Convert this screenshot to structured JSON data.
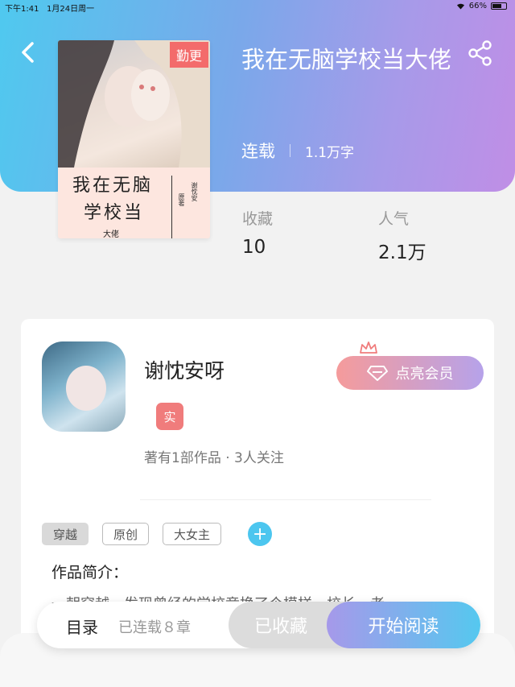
{
  "status_bar": {
    "time": "下午1:41",
    "date": "1月24日周一",
    "battery": "66%",
    "battery_level": 0.66
  },
  "header": {
    "back_icon": "chevron-left-icon",
    "share_icon": "share-icon"
  },
  "book": {
    "cover_badge": "勤更",
    "cover_title_line1": "我在无脑",
    "cover_title_line2": "学校当",
    "cover_title_line3": "大佬",
    "cover_author": "谢忱安",
    "cover_author_label": "原著",
    "title": "我在无脑学校当大佬",
    "status": "连载",
    "word_count": "1.1万字"
  },
  "stats": {
    "favorites_label": "收藏",
    "favorites_value": "10",
    "popularity_label": "人气",
    "popularity_value": "2.1万"
  },
  "author": {
    "name": "谢忱安呀",
    "verified_badge": "实",
    "info": "著有1部作品 · 3人关注",
    "vip_button": "点亮会员"
  },
  "tags": [
    "穿越",
    "原创",
    "大女主"
  ],
  "intro": {
    "label": "作品简介：",
    "text": "一朝穿越，发现曾经的学校竟换了个模样，校长，老"
  },
  "bottom_bar": {
    "toc_label": "目录",
    "chapters": "已连载８章",
    "collected_label": "已收藏",
    "read_label": "开始阅读"
  },
  "colors": {
    "hero_start": "#4fc9ef",
    "hero_end": "#c08ee6",
    "accent_red": "#f36b6b",
    "tag_plus": "#4cc6ef"
  }
}
